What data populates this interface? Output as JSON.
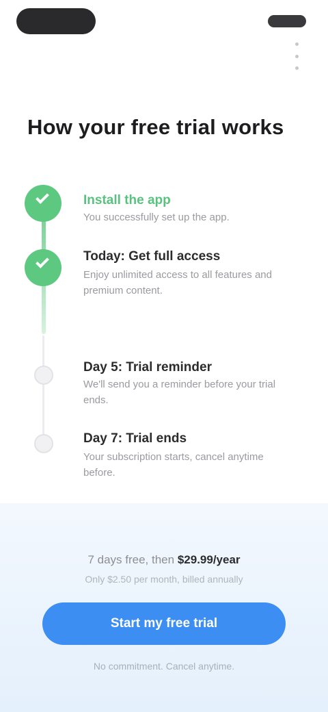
{
  "header": {
    "title": "How your free trial works"
  },
  "steps": [
    {
      "title": "Install the app",
      "description": "You successfully set up the app.",
      "state": "done"
    },
    {
      "title": "Today: Get full access",
      "description": "Enjoy unlimited access to all features and premium content.",
      "state": "done"
    },
    {
      "title": "Day 5: Trial reminder",
      "description": "We'll send you a reminder before your trial ends.",
      "state": "todo"
    },
    {
      "title": "Day 7: Trial ends",
      "description": "Your subscription starts, cancel anytime before.",
      "state": "todo"
    }
  ],
  "pricing": {
    "prefix": "7 days free, then",
    "price": "$29.99/year",
    "subtext": "Only $2.50 per month, billed annually"
  },
  "cta": {
    "label": "Start my free trial"
  },
  "footer": {
    "note": "No commitment. Cancel anytime."
  },
  "colors": {
    "done": "#5cc880",
    "accent": "#3d8ef3",
    "panel": "#e4f0fc"
  }
}
